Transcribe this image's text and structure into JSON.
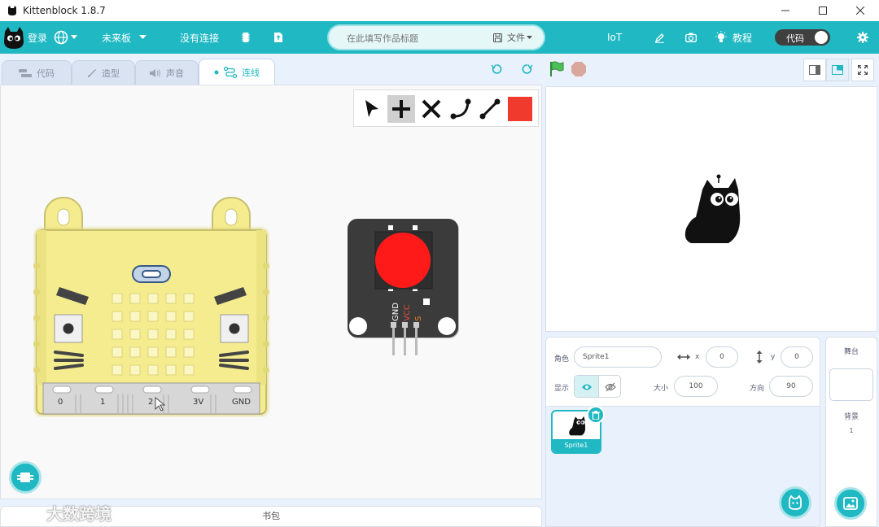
{
  "window": {
    "title": "Kittenblock 1.8.7"
  },
  "menubar": {
    "login": "登录",
    "board": "未来板",
    "connection": "没有连接",
    "title_placeholder": "在此填写作品标题",
    "file": "文件",
    "iot": "IoT",
    "tutorial": "教程",
    "code_toggle": "代码"
  },
  "tabs": [
    {
      "label": "代码",
      "icon": "code-icon"
    },
    {
      "label": "造型",
      "icon": "brush-icon"
    },
    {
      "label": "声音",
      "icon": "speaker-icon"
    },
    {
      "label": "连线",
      "icon": "wiring-icon",
      "active": true
    }
  ],
  "board": {
    "pins": [
      "0",
      "1",
      "2",
      "3V",
      "GND"
    ]
  },
  "module": {
    "pin_labels": [
      "GND",
      "VCC",
      "S"
    ]
  },
  "backpack": {
    "label": "书包"
  },
  "sprite_info": {
    "sprite_label": "角色",
    "sprite_name": "Sprite1",
    "x_label": "x",
    "x_value": "0",
    "y_label": "y",
    "y_value": "0",
    "show_label": "显示",
    "size_label": "大小",
    "size_value": "100",
    "direction_label": "方向",
    "direction_value": "90"
  },
  "sprites": [
    {
      "name": "Sprite1"
    }
  ],
  "stage_panel": {
    "title": "舞台",
    "backdrop_label": "背景",
    "backdrop_count": "1"
  },
  "watermark": "大数跨境",
  "colors": {
    "accent": "#1fb8c3",
    "board": "#f4ec8f",
    "led": "#ff1a1a"
  }
}
